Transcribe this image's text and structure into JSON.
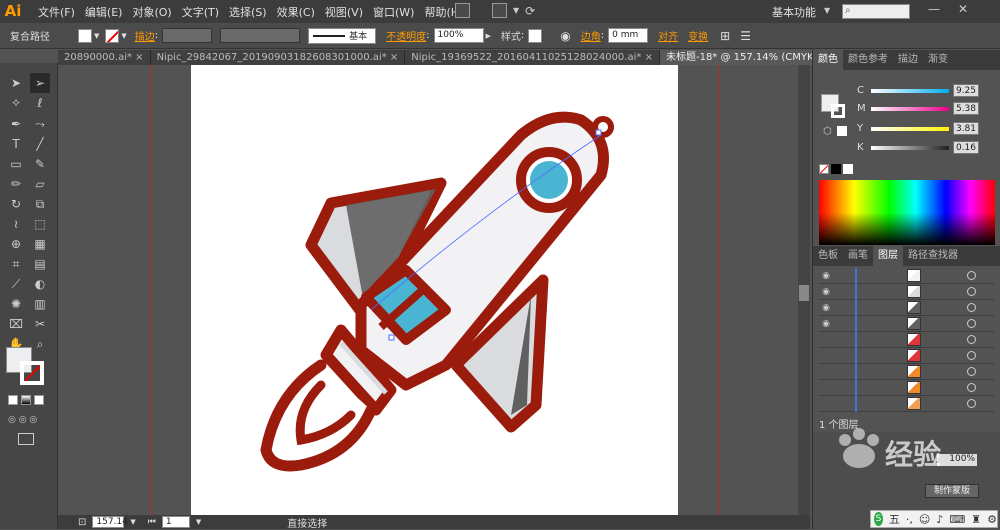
{
  "app": {
    "logo": "Ai"
  },
  "menu": [
    "文件(F)",
    "编辑(E)",
    "对象(O)",
    "文字(T)",
    "选择(S)",
    "效果(C)",
    "视图(V)",
    "窗口(W)",
    "帮助(H)"
  ],
  "workspace": "基本功能",
  "control_bar": {
    "selection_label": "复合路径",
    "stroke_label": "描边",
    "stroke_style": "基本",
    "opacity_label": "不透明度",
    "opacity_value": "100%",
    "style_label": "样式",
    "corner_label": "边角",
    "corner_value": "0 mm",
    "align_label": "对齐",
    "transform_label": "变换"
  },
  "tabs": [
    {
      "label": "20890000.ai*",
      "active": false
    },
    {
      "label": "Nipic_29842067_20190903182608301000.ai*",
      "active": false
    },
    {
      "label": "Nipic_19369522_20160411025128024000.ai*",
      "active": false
    },
    {
      "label": "未标题-18* @ 157.14% (CMYK/预览)",
      "active": true
    }
  ],
  "status": {
    "zoom": "157.14",
    "page": "1",
    "tool": "直接选择"
  },
  "color_panel": {
    "tabs": [
      "颜色",
      "颜色参考",
      "描边",
      "渐变"
    ],
    "sliders": [
      {
        "label": "C",
        "value": "9.25",
        "color": "#00aeef"
      },
      {
        "label": "M",
        "value": "5.38",
        "color": "#ec008c"
      },
      {
        "label": "Y",
        "value": "3.81",
        "color": "#fff200"
      },
      {
        "label": "K",
        "value": "0.16",
        "color": "#231f20"
      }
    ]
  },
  "layers_panel": {
    "tabs": [
      "色板",
      "画笔",
      "图层",
      "路径查找器"
    ],
    "footer": "1 个图层",
    "rows": [
      {
        "eye": true,
        "thumb": "rocket-body"
      },
      {
        "eye": true,
        "thumb": "fin"
      },
      {
        "eye": true,
        "thumb": "fin-dark"
      },
      {
        "eye": true,
        "thumb": "fin-dark"
      },
      {
        "eye": false,
        "thumb": "red-shape"
      },
      {
        "eye": false,
        "thumb": "red-circle"
      },
      {
        "eye": false,
        "thumb": "orange-shape"
      },
      {
        "eye": false,
        "thumb": "orange-circle"
      },
      {
        "eye": false,
        "thumb": "orange-stripe"
      }
    ]
  },
  "lower_panel": {
    "value": "100%",
    "button": "制作蒙版"
  },
  "watermark": "经验",
  "ime": {
    "label": "五"
  },
  "colors": {
    "outline": "#9b1c0d",
    "window": "#4ab5d3",
    "body": "#f2f2f4",
    "shadow": "#606060",
    "fin_light": "#d9dbdf"
  }
}
